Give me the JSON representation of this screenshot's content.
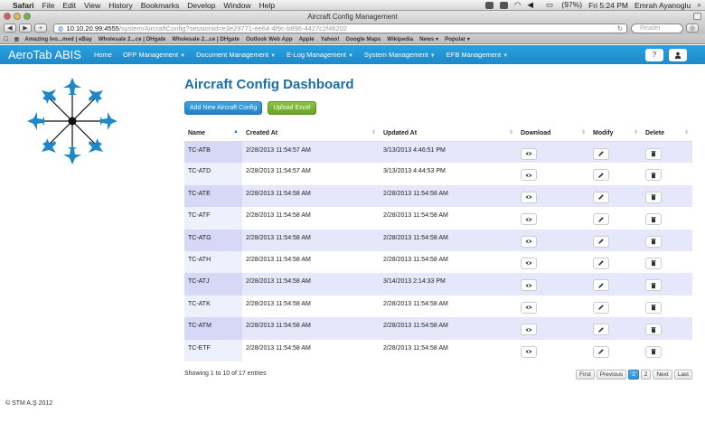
{
  "menubar": {
    "items": [
      "Safari",
      "File",
      "Edit",
      "View",
      "History",
      "Bookmarks",
      "Develop",
      "Window",
      "Help"
    ],
    "battery": "(97%)",
    "clock": "Fri 5:24 PM",
    "user": "Emrah Ayanoglu"
  },
  "window": {
    "title": "Aircraft Config Management"
  },
  "browser": {
    "url_host": "10.10.20.99:4555",
    "url_path": "/system/AircraftConfig?sessionId=e3e29771-ee64-4f9c-b896-4427c2f46202",
    "reader_label": "Reader",
    "bookmarks": [
      "Amazing Ivo...med | eBay",
      "Wholesale 2...ce | DHgate",
      "Wholesale 2...ce | DHgate",
      "Outlook Web App",
      "Apple",
      "Yahoo!",
      "Google Maps",
      "Wikipedia",
      "News",
      "Popular"
    ]
  },
  "nav": {
    "brand": "AeroTab ABIS",
    "items": [
      {
        "label": "Home",
        "dropdown": false
      },
      {
        "label": "OFP Management",
        "dropdown": true
      },
      {
        "label": "Document Management",
        "dropdown": true
      },
      {
        "label": "E-Log Management",
        "dropdown": true
      },
      {
        "label": "System Management",
        "dropdown": true
      },
      {
        "label": "EFB Management",
        "dropdown": true
      }
    ],
    "icons": [
      "help-icon",
      "user-icon"
    ]
  },
  "page": {
    "title": "Aircraft Config Dashboard",
    "add_button": "Add New Aircraft Config",
    "upload_button": "Upload Excel"
  },
  "table": {
    "columns": [
      "Name",
      "Created At",
      "Updated At",
      "Download",
      "Modify",
      "Delete"
    ],
    "rows": [
      {
        "name": "TC-ATB",
        "created": "2/28/2013 11:54:57 AM",
        "updated": "3/13/2013 4:46:51 PM"
      },
      {
        "name": "TC-ATD",
        "created": "2/28/2013 11:54:57 AM",
        "updated": "3/13/2013 4:44:53 PM"
      },
      {
        "name": "TC-ATE",
        "created": "2/28/2013 11:54:58 AM",
        "updated": "2/28/2013 11:54:58 AM"
      },
      {
        "name": "TC-ATF",
        "created": "2/28/2013 11:54:58 AM",
        "updated": "2/28/2013 11:54:58 AM"
      },
      {
        "name": "TC-ATG",
        "created": "2/28/2013 11:54:58 AM",
        "updated": "2/28/2013 11:54:58 AM"
      },
      {
        "name": "TC-ATH",
        "created": "2/28/2013 11:54:58 AM",
        "updated": "2/28/2013 11:54:58 AM"
      },
      {
        "name": "TC-ATJ",
        "created": "2/28/2013 11:54:58 AM",
        "updated": "3/14/2013 2:14:33 PM"
      },
      {
        "name": "TC-ATK",
        "created": "2/28/2013 11:54:58 AM",
        "updated": "2/28/2013 11:54:58 AM"
      },
      {
        "name": "TC-ATM",
        "created": "2/28/2013 11:54:58 AM",
        "updated": "2/28/2013 11:54:58 AM"
      },
      {
        "name": "TC-ETF",
        "created": "2/28/2013 11:54:58 AM",
        "updated": "2/28/2013 11:54:58 AM"
      }
    ],
    "row_icons": {
      "download": "eye-icon",
      "modify": "pencil-icon",
      "delete": "trash-icon"
    }
  },
  "pagination": {
    "summary": "Showing 1 to 10 of 17 entries",
    "first": "First",
    "previous": "Previous",
    "pages": [
      "1",
      "2"
    ],
    "current": "1",
    "next": "Next",
    "last": "Last"
  },
  "footer": {
    "text": "© STM A.Ş 2012"
  },
  "colors": {
    "navbar": "#1d89ca",
    "title": "#1b6fa6",
    "add_button": "#1f82c9",
    "upload_button": "#6aa326",
    "row_stripe": "#e6e7fa"
  }
}
